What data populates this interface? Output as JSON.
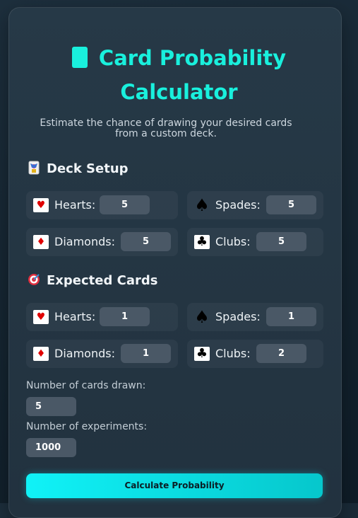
{
  "header": {
    "title_line1": "Card Probability",
    "title_line2": "Calculator",
    "subtitle_line1": "Estimate the chance of drawing your desired cards",
    "subtitle_line2": "from a custom deck."
  },
  "deck_setup": {
    "title": "Deck Setup",
    "fields": [
      {
        "label": "Hearts:",
        "value": "5"
      },
      {
        "label": "Spades:",
        "value": "5"
      },
      {
        "label": "Diamonds:",
        "value": "5"
      },
      {
        "label": "Clubs:",
        "value": "5"
      }
    ]
  },
  "expected_cards": {
    "title": "Expected Cards",
    "fields": [
      {
        "label": "Hearts:",
        "value": "1"
      },
      {
        "label": "Spades:",
        "value": "1"
      },
      {
        "label": "Diamonds:",
        "value": "1"
      },
      {
        "label": "Clubs:",
        "value": "2"
      }
    ]
  },
  "settings": {
    "cards_drawn_label": "Number of cards drawn:",
    "cards_drawn_value": "5",
    "experiments_label": "Number of experiments:",
    "experiments_value": "1000"
  },
  "actions": {
    "calculate_label": "Calculate Probability"
  },
  "icons": {
    "title": "card-icon",
    "deck_setup": "joker-card-icon",
    "expected_cards": "target-icon",
    "hearts": "heart-icon",
    "spades": "spade-icon",
    "diamonds": "diamond-icon",
    "clubs": "club-icon"
  },
  "colors": {
    "accent": "#19f0dd",
    "button": "#10f2f7",
    "input_bg": "#4a5866"
  }
}
